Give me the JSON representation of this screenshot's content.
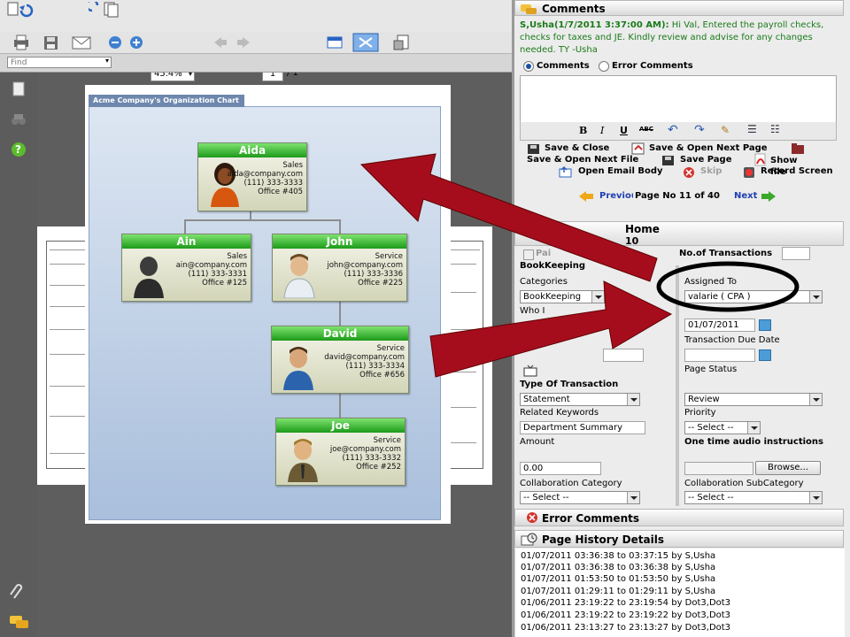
{
  "viewer": {
    "find_placeholder": "Find",
    "zoom": "45.4%",
    "page_current": "1",
    "page_total": "/ 1"
  },
  "org_chart": {
    "title": "Acme Company's Organization Chart",
    "people": [
      {
        "name": "Aida",
        "dept": "Sales",
        "email": "aida@company.com",
        "phone": "(111) 333-3333",
        "office": "Office #405"
      },
      {
        "name": "Ain",
        "dept": "Sales",
        "email": "ain@company.com",
        "phone": "(111) 333-3331",
        "office": "Office #125"
      },
      {
        "name": "John",
        "dept": "Service",
        "email": "john@company.com",
        "phone": "(111) 333-3336",
        "office": "Office #225"
      },
      {
        "name": "David",
        "dept": "Service",
        "email": "david@company.com",
        "phone": "(111) 333-3334",
        "office": "Office #656"
      },
      {
        "name": "Joe",
        "dept": "Service",
        "email": "joe@company.com",
        "phone": "(111) 333-3332",
        "office": "Office #252"
      }
    ]
  },
  "comments": {
    "header": "Comments",
    "message_author": "S,Usha(1/7/2011 3:37:00 AM):",
    "message_body": " Hi Val, Entered the payroll checks, checks for taxes and JE. Kindly review and advise for any changes needed. TY -Usha",
    "radio_comments": "Comments",
    "radio_error_comments": "Error Comments"
  },
  "actions": {
    "save_close": "Save & Close",
    "save_open_next_page": "Save & Open Next Page",
    "save_open_next_file": "Save & Open Next File",
    "save_page": "Save Page",
    "show_file": "Show file",
    "open_email_body": "Open Email Body",
    "skip": "Skip",
    "record_screen": "Record Screen"
  },
  "pagination": {
    "previous": "Previous",
    "page_label": "Page No 11 of 40",
    "next": "Next"
  },
  "form": {
    "section_title": "Home",
    "section_sub": "10",
    "paid_label": "Pai",
    "no_of_transactions_label": "No.of Transactions",
    "no_of_transactions_value": "",
    "bookkeeping_label": "BookKeeping",
    "categories_label": "Categories",
    "categories_value": "BookKeeping",
    "assigned_to_label": "Assigned To",
    "assigned_to_value": "valarie ( CPA )",
    "who_label": "Who I",
    "transaction_date_value": "01/07/2011",
    "transaction_due_date_label": "Transaction Due Date",
    "transaction_due_date_value": "",
    "page_status_label": "Page Status",
    "page_status_value": "Review",
    "type_of_transaction_label": "Type Of Transaction",
    "type_of_transaction_value": "Statement",
    "related_keywords_label": "Related Keywords",
    "related_keywords_value": "Department Summary",
    "priority_label": "Priority",
    "priority_value": "-- Select --",
    "amount_label": "Amount",
    "amount_value": "0.00",
    "audio_label": "One time audio instructions",
    "browse_button": "Browse...",
    "collab_category_label": "Collaboration Category",
    "collab_category_value": "-- Select --",
    "collab_subcategory_label": "Collaboration SubCategory",
    "collab_subcategory_value": "-- Select --"
  },
  "error_comments": {
    "header": "Error Comments"
  },
  "history": {
    "header": "Page History Details",
    "rows": [
      "01/07/2011 03:36:38 to 03:37:15 by S,Usha",
      "01/07/2011 03:36:38 to 03:36:38 by S,Usha",
      "01/07/2011 01:53:50 to 01:53:50 by S,Usha",
      "01/07/2011 01:29:11 to 01:29:11 by S,Usha",
      "01/06/2011 23:19:22 to 23:19:54 by Dot3,Dot3",
      "01/06/2011 23:19:22 to 23:19:22 by Dot3,Dot3",
      "01/06/2011 23:13:27 to 23:13:27 by Dot3,Dot3"
    ]
  },
  "colors": {
    "comment_text": "#1a7a1a",
    "arrow": "#a50d1d",
    "link_blue": "#1f3fb0",
    "card_header": "#2fae25"
  }
}
